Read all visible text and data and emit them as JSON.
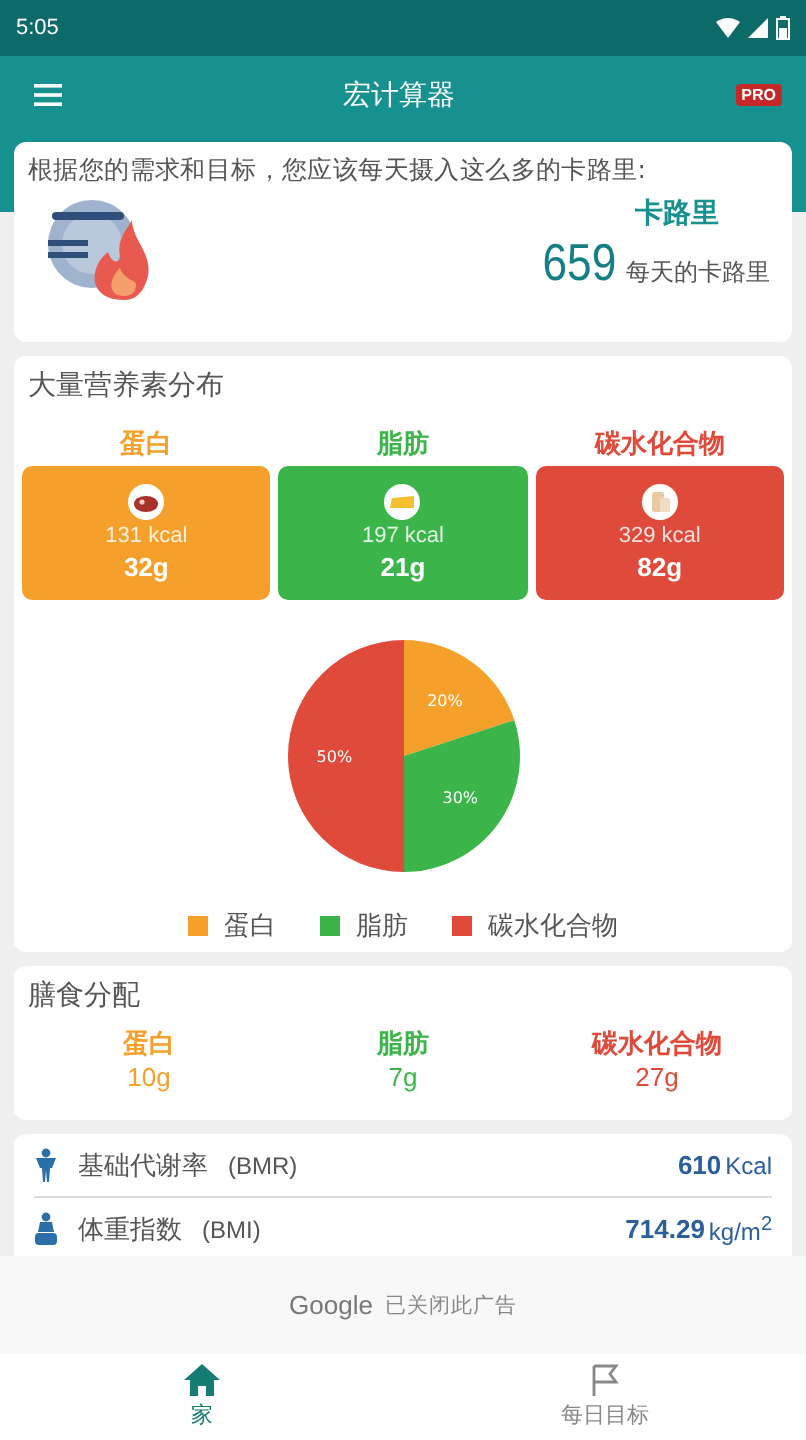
{
  "status_bar": {
    "time": "5:05"
  },
  "app_bar": {
    "title": "宏计算器",
    "badge": "PRO"
  },
  "calorie_card": {
    "intro": "根据您的需求和目标，您应该每天摄入这么多的卡路里:",
    "heading": "卡路里",
    "value": "659",
    "unit": "每天的卡路里"
  },
  "macro_card": {
    "title": "大量营养素分布",
    "macros": [
      {
        "name": "蛋白",
        "kcal": "131 kcal",
        "grams": "32g",
        "color": "#f5a02a",
        "kind": "meat"
      },
      {
        "name": "脂肪",
        "kcal": "197 kcal",
        "grams": "21g",
        "color": "#3bb54a",
        "kind": "cheese"
      },
      {
        "name": "碳水化合物",
        "kcal": "329 kcal",
        "grams": "82g",
        "color": "#e04a3b",
        "kind": "bread"
      }
    ],
    "chart_data": {
      "type": "pie",
      "categories": [
        "蛋白",
        "脂肪",
        "碳水化合物"
      ],
      "values": [
        20,
        30,
        50
      ],
      "colors": [
        "#f5a02a",
        "#3bb54a",
        "#e04a3b"
      ],
      "data_labels": true,
      "value_labels": [
        "20%",
        "30%",
        "50%"
      ]
    }
  },
  "meal_card": {
    "title": "膳食分配",
    "items": [
      {
        "name": "蛋白",
        "grams": "10g",
        "color": "#f5a02a"
      },
      {
        "name": "脂肪",
        "grams": "7g",
        "color": "#3bb54a"
      },
      {
        "name": "碳水化合物",
        "grams": "27g",
        "color": "#e04a3b"
      }
    ]
  },
  "stats": [
    {
      "kind": "bmr",
      "label": "基础代谢率",
      "abbr": "(BMR)",
      "value": "610",
      "unit": "Kcal"
    },
    {
      "kind": "bmi",
      "label": "体重指数",
      "abbr": "(BMI)",
      "value": "714.29",
      "unit": "kg/m$^{2}$"
    }
  ],
  "ad_notice": {
    "brand": "Google",
    "text": "已关闭此广告"
  },
  "bottom_nav": [
    {
      "label": "家",
      "kind": "home",
      "selected": true
    },
    {
      "label": "每日目标",
      "kind": "goal",
      "selected": false
    }
  ]
}
